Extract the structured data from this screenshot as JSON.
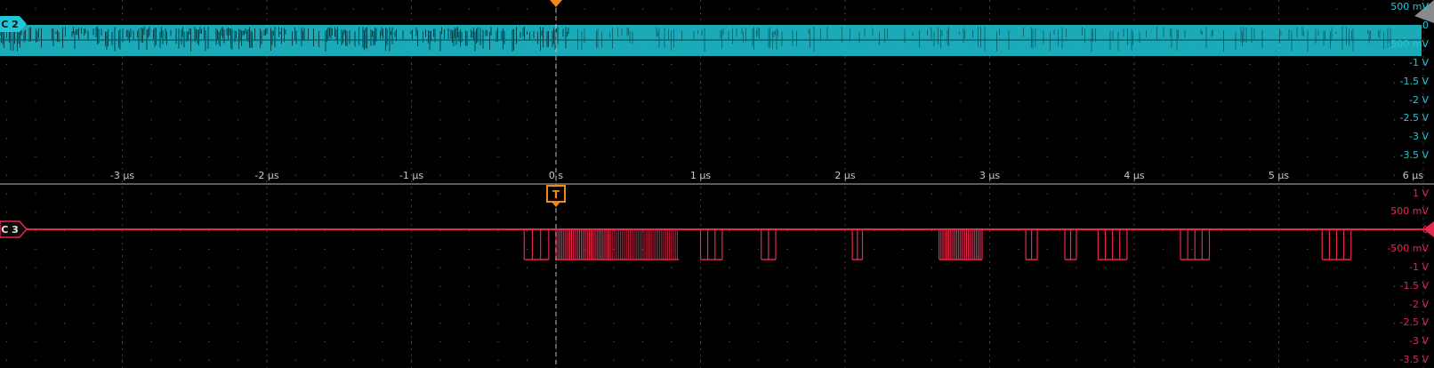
{
  "window": {
    "title": ""
  },
  "channels": [
    {
      "id": "C2",
      "label": "C 2",
      "color": "#1fc8d8",
      "y_ticks": [
        "500 mV",
        "0",
        "-500 mV",
        "-1 V",
        "-1.5 V",
        "-2 V",
        "-2.5 V",
        "-3 V",
        "-3.5 V"
      ]
    },
    {
      "id": "C3",
      "label": "C 3",
      "color": "#e8264e",
      "y_ticks": [
        "1 V",
        "500 mV",
        "0",
        "-500 mV",
        "-1 V",
        "-1.5 V",
        "-2 V",
        "-2.5 V",
        "-3 V",
        "-3.5 V"
      ]
    }
  ],
  "time_axis": {
    "ticks": [
      "-3 µs",
      "-2 µs",
      "-1 µs",
      "0 s",
      "1 µs",
      "2 µs",
      "3 µs",
      "4 µs",
      "5 µs",
      "6 µs"
    ]
  },
  "trigger": {
    "label": "T",
    "color": "#f08a1c"
  },
  "chart_data": {
    "type": "line",
    "xlabel": "",
    "ylabel": "",
    "xlim_us": [
      -3.8,
      6.0
    ],
    "series": [
      {
        "name": "C 2",
        "signal": "dense high-frequency digital activity, continuous",
        "approx_levels_V": [
          0.35,
          -0.35
        ]
      },
      {
        "name": "C 3",
        "idle_level_V": 0.0,
        "low_level_V": -0.8,
        "pulse_groups_us": [
          [
            -0.22,
            -0.05
          ],
          [
            0.0,
            0.85
          ],
          [
            1.0,
            1.15
          ],
          [
            1.42,
            1.52
          ],
          [
            2.05,
            2.12
          ],
          [
            2.65,
            2.95
          ],
          [
            3.25,
            3.33
          ],
          [
            3.52,
            3.6
          ],
          [
            3.75,
            3.95
          ],
          [
            4.32,
            4.52
          ],
          [
            5.3,
            5.5
          ]
        ]
      }
    ]
  }
}
